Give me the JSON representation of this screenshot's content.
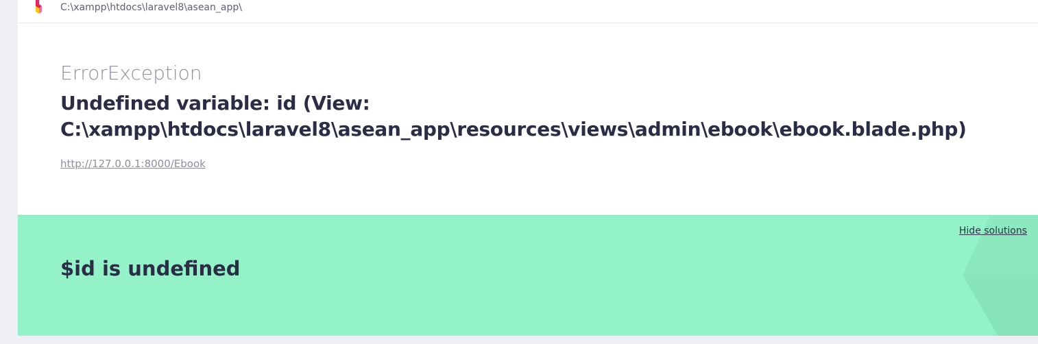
{
  "header": {
    "path": "C:\\xampp\\htdocs\\laravel8\\asean_app\\",
    "logo_icon": "ignition-logo-icon"
  },
  "exception": {
    "class": "ErrorException",
    "message": "Undefined variable: id (View: C:\\xampp\\htdocs\\laravel8\\asean_app\\resources\\views\\admin\\ebook\\ebook.blade.php)",
    "url": "http://127.0.0.1:8000/Ebook"
  },
  "solution": {
    "hide_label": "Hide solutions",
    "title": "$id is undefined"
  },
  "colors": {
    "solution_bg": "#94f2c8",
    "text_dark": "#2b2c45",
    "text_muted": "#8e8ea3",
    "page_bg": "#eeeef5"
  }
}
